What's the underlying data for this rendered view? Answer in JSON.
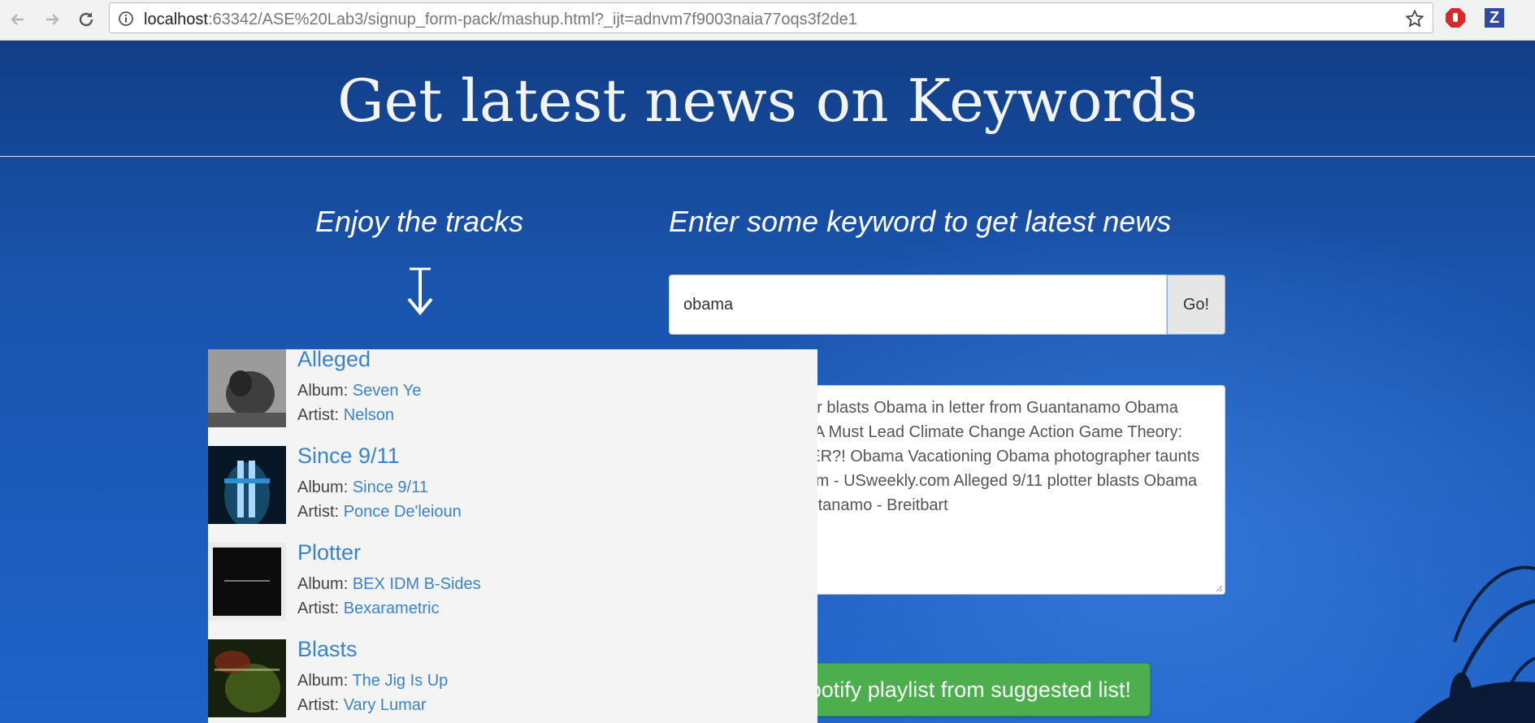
{
  "browser": {
    "url_host": "localhost",
    "url_rest": ":63342/ASE%20Lab3/signup_form-pack/mashup.html?_ijt=adnvm7f9003naia77oqs3f2de1",
    "ext_z_label": "Z"
  },
  "page": {
    "title": "Get latest news on Keywords",
    "tracks_heading": "Enjoy the tracks",
    "news_heading": "Enter some keyword to get latest news",
    "search": {
      "value": "obama"
    },
    "go_label": "Go!",
    "news_text": "Alleged 9/11 plotter blasts Obama in letter from Guantanamo Obama EPA Head Says CA Must Lead Climate Change Action Game Theory: OBAMA IS TRACER?!   Obama Vacationing Obama photographer taunts Trump on Instagram - USweekly.com Alleged 9/11 plotter blasts Obama in letter from Guantanamo - Breitbart",
    "playlist_label": "Create Spotify playlist from suggested list!",
    "album_label": "Album:",
    "artist_label": "Artist:"
  },
  "tracks": [
    {
      "title": "Alleged",
      "album": "Seven Ye",
      "artist": "Nelson"
    },
    {
      "title": "Since 9/11",
      "album": "Since 9/11",
      "artist": "Ponce De'leioun"
    },
    {
      "title": "Plotter",
      "album": "BEX IDM B-Sides",
      "artist": "Bexarametric"
    },
    {
      "title": "Blasts",
      "album": "The Jig Is Up",
      "artist": "Vary Lumar"
    }
  ],
  "colors": {
    "link": "#3a84c7",
    "button_green": "#4cae4c",
    "page_blue": "#1a57b4"
  }
}
